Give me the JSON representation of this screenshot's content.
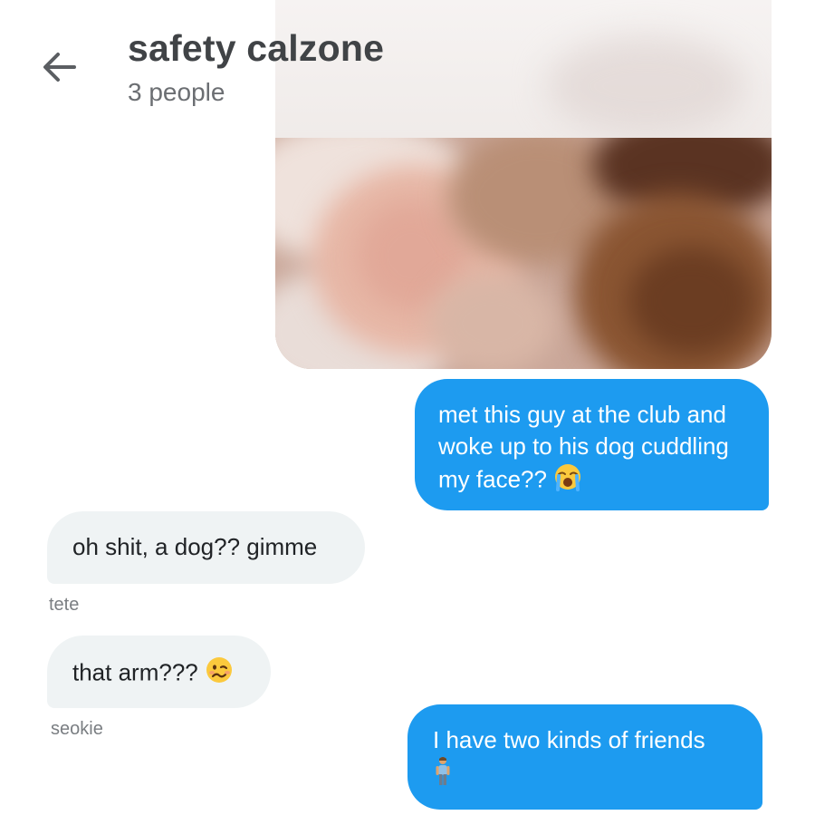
{
  "header": {
    "title": "safety calzone",
    "subtitle": "3 people",
    "back_icon": "arrow-left-icon"
  },
  "colors": {
    "outgoing_bubble": "#1d9bf0",
    "incoming_bubble": "#eff3f4",
    "title_text": "#404346",
    "meta_text": "#7a7e82"
  },
  "messages": [
    {
      "direction": "outgoing",
      "type": "image",
      "description_icon": "blurred-photo"
    },
    {
      "direction": "outgoing",
      "text": "met this guy at the club and woke up to his dog cuddling my face??",
      "emoji": "crying-face-icon"
    },
    {
      "direction": "incoming",
      "text": "oh shit, a dog?? gimme",
      "sender": "tete"
    },
    {
      "direction": "incoming",
      "text": "that arm???",
      "emoji": "woozy-face-icon",
      "sender": "seokie"
    },
    {
      "direction": "outgoing",
      "text": "I have two kinds of friends",
      "emoji": "person-standing-icon"
    }
  ]
}
